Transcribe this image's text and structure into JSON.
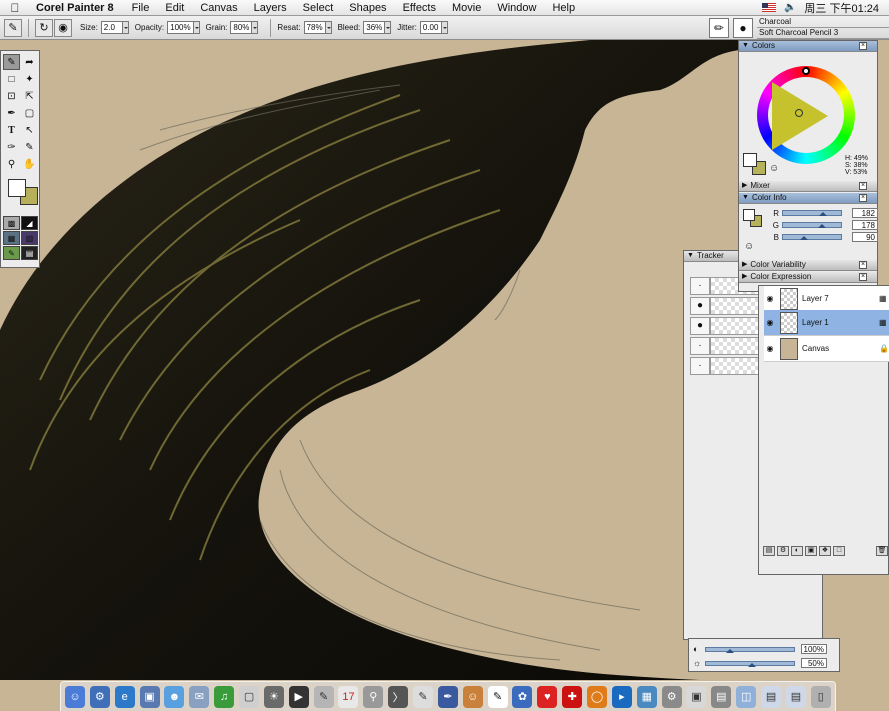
{
  "menubar": {
    "app_name": "Corel Painter 8",
    "menus": [
      "File",
      "Edit",
      "Canvas",
      "Layers",
      "Select",
      "Shapes",
      "Effects",
      "Movie",
      "Window",
      "Help"
    ],
    "clock": "周三 下午01:24"
  },
  "property_bar": {
    "size_label": "Size:",
    "size_value": "2.0",
    "opacity_label": "Opacity:",
    "opacity_value": "100%",
    "grain_label": "Grain:",
    "grain_value": "80%",
    "resat_label": "Resat:",
    "resat_value": "78%",
    "bleed_label": "Bleed:",
    "bleed_value": "36%",
    "jitter_label": "Jitter:",
    "jitter_value": "0.00"
  },
  "brush_selector": {
    "category": "Charcoal",
    "variant": "Soft Charcoal Pencil 3"
  },
  "colors_panel": {
    "title": "Colors",
    "hsv": {
      "h": "H: 49%",
      "s": "S: 38%",
      "v": "V: 53%"
    },
    "main_color": "#b6b25a",
    "secondary_color": "#ffffff"
  },
  "mixer_panel": {
    "title": "Mixer"
  },
  "color_info_panel": {
    "title": "Color Info",
    "r_label": "R",
    "r_value": "182",
    "g_label": "G",
    "g_value": "178",
    "b_label": "B",
    "b_value": "90"
  },
  "color_variability_panel": {
    "title": "Color Variability"
  },
  "color_expression_panel": {
    "title": "Color Expression"
  },
  "tracker_panel": {
    "title": "Tracker"
  },
  "layers_panel": {
    "layers": [
      {
        "name": "Layer 7",
        "selected": false
      },
      {
        "name": "Layer 1",
        "selected": true
      },
      {
        "name": "Canvas",
        "selected": false,
        "locked": true
      }
    ]
  },
  "opacity_strip": {
    "opacity_value": "100%",
    "grain_value": "50%"
  },
  "canvas": {
    "background_color": "#c7b596",
    "accent_color": "#b6b05a"
  }
}
